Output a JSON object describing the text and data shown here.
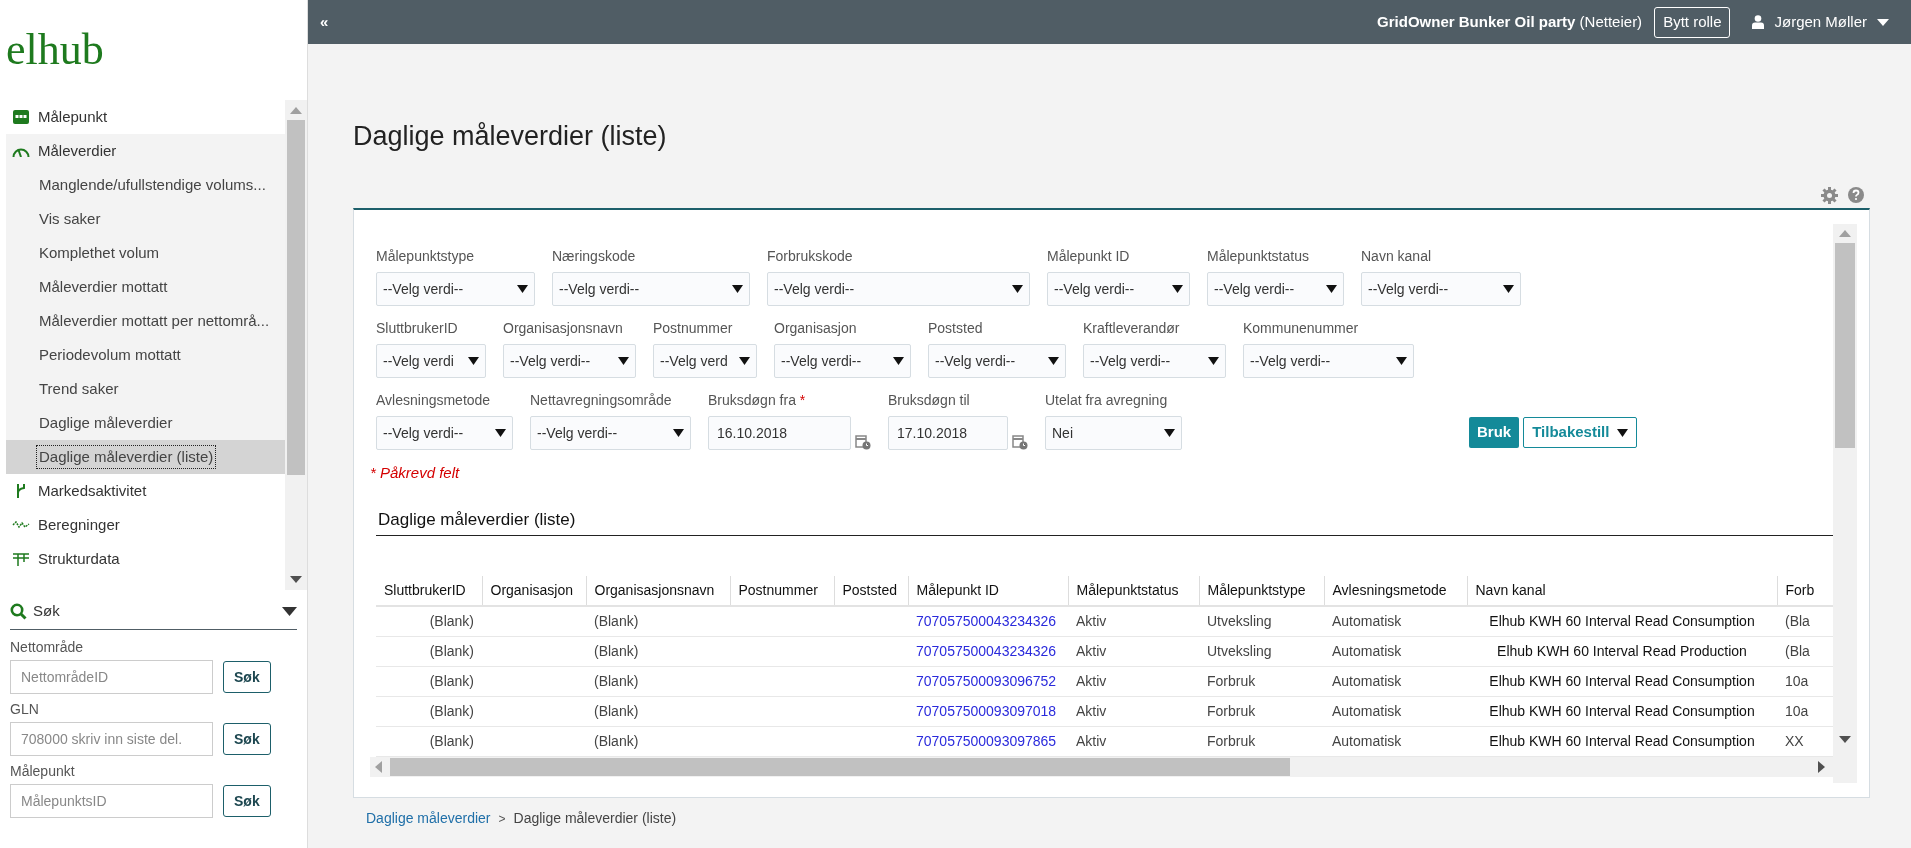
{
  "topbar": {
    "collapse": "«",
    "organization": "GridOwner Bunker Oil party",
    "role": "(Netteier)",
    "switch_role": "Bytt rolle",
    "user": "Jørgen Møller"
  },
  "logo": "elhub",
  "sidebar": {
    "items": [
      {
        "label": "Målepunkt",
        "expanded": false,
        "selected": false
      },
      {
        "label": "Måleverdier",
        "expanded": true,
        "selected": false,
        "children": [
          {
            "label": "Manglende/ufullstendige volums...",
            "selected": false
          },
          {
            "label": "Vis saker",
            "selected": false
          },
          {
            "label": "Komplethet volum",
            "selected": false
          },
          {
            "label": "Måleverdier mottatt",
            "selected": false
          },
          {
            "label": "Måleverdier mottatt per nettområ...",
            "selected": false
          },
          {
            "label": "Periodevolum mottatt",
            "selected": false
          },
          {
            "label": "Trend saker",
            "selected": false
          },
          {
            "label": "Daglige måleverdier",
            "selected": false
          },
          {
            "label": "Daglige måleverdier (liste)",
            "selected": true
          }
        ]
      },
      {
        "label": "Markedsaktivitet",
        "expanded": false,
        "selected": false
      },
      {
        "label": "Beregninger",
        "expanded": false,
        "selected": false
      },
      {
        "label": "Strukturdata",
        "expanded": false,
        "selected": false
      }
    ]
  },
  "quick_search": {
    "title": "Søk",
    "fields": [
      {
        "label": "Nettområde",
        "placeholder": "NettområdeID",
        "button": "Søk"
      },
      {
        "label": "GLN",
        "placeholder": "708000 skriv inn siste del.",
        "button": "Søk"
      },
      {
        "label": "Målepunkt",
        "placeholder": "MålepunktsID",
        "button": "Søk"
      }
    ]
  },
  "page_title": "Daglige måleverdier (liste)",
  "filters": [
    [
      {
        "kind": "select",
        "label": "Målepunktstype",
        "value": "--Velg verdi--"
      },
      {
        "kind": "select",
        "label": "Næringskode",
        "value": "--Velg verdi--"
      },
      {
        "kind": "select",
        "label": "Forbrukskode",
        "value": "--Velg verdi--"
      },
      {
        "kind": "select",
        "label": "Målepunkt ID",
        "value": "--Velg verdi--"
      },
      {
        "kind": "select",
        "label": "Målepunktstatus",
        "value": "--Velg verdi--"
      },
      {
        "kind": "select",
        "label": "Navn kanal",
        "value": "--Velg verdi--"
      }
    ],
    [
      {
        "kind": "select",
        "label": "SluttbrukerID",
        "value": "--Velg verdi"
      },
      {
        "kind": "select",
        "label": "Organisasjonsnavn",
        "value": "--Velg verdi--"
      },
      {
        "kind": "select",
        "label": "Postnummer",
        "value": "--Velg verd"
      },
      {
        "kind": "select",
        "label": "Organisasjon",
        "value": "--Velg verdi--"
      },
      {
        "kind": "select",
        "label": "Poststed",
        "value": "--Velg verdi--"
      },
      {
        "kind": "select",
        "label": "Kraftleverandør",
        "value": "--Velg verdi--"
      },
      {
        "kind": "select",
        "label": "Kommunenummer",
        "value": "--Velg verdi--"
      }
    ],
    [
      {
        "kind": "select",
        "label": "Avlesningsmetode",
        "value": "--Velg verdi--"
      },
      {
        "kind": "select",
        "label": "Nettavregningsområde",
        "value": "--Velg verdi--"
      },
      {
        "kind": "date",
        "label": "Bruksdøgn fra",
        "required": true,
        "value": "16.10.2018"
      },
      {
        "kind": "date",
        "label": "Bruksdøgn til",
        "required": false,
        "value": "17.10.2018"
      },
      {
        "kind": "select",
        "label": "Utelat fra avregning",
        "value": "Nei"
      }
    ]
  ],
  "required_mark": "*",
  "apply_button": "Bruk",
  "reset_button": "Tilbakestill",
  "required_note": "* Påkrevd felt",
  "section_title": "Daglige måleverdier (liste)",
  "table": {
    "columns": [
      {
        "label": "SluttbrukerID",
        "kind": "right"
      },
      {
        "label": "Organisasjon"
      },
      {
        "label": "Organisasjonsnavn",
        "kind": "text"
      },
      {
        "label": "Postnummer"
      },
      {
        "label": "Poststed"
      },
      {
        "label": "Målepunkt ID",
        "kind": "link"
      },
      {
        "label": "Målepunktstatus",
        "kind": "text"
      },
      {
        "label": "Målepunktstype",
        "kind": "text"
      },
      {
        "label": "Avlesningsmetode",
        "kind": "text"
      },
      {
        "label": "Navn kanal",
        "kind": "strong"
      },
      {
        "label": "Forb",
        "kind": "text"
      }
    ],
    "rows": [
      {
        "cells": [
          "(Blank)",
          null,
          "(Blank)",
          null,
          null,
          "707057500043234326",
          "Aktiv",
          "Utveksling",
          "Automatisk",
          "Elhub KWH 60 Interval Read Consumption",
          "(Bla"
        ]
      },
      {
        "cells": [
          "(Blank)",
          null,
          "(Blank)",
          null,
          null,
          "707057500043234326",
          "Aktiv",
          "Utveksling",
          "Automatisk",
          "Elhub KWH 60 Interval Read Production",
          "(Bla"
        ]
      },
      {
        "cells": [
          "(Blank)",
          null,
          "(Blank)",
          null,
          null,
          "707057500093096752",
          "Aktiv",
          "Forbruk",
          "Automatisk",
          "Elhub KWH 60 Interval Read Consumption",
          "10a"
        ]
      },
      {
        "cells": [
          "(Blank)",
          null,
          "(Blank)",
          null,
          null,
          "707057500093097018",
          "Aktiv",
          "Forbruk",
          "Automatisk",
          "Elhub KWH 60 Interval Read Consumption",
          "10a"
        ]
      },
      {
        "cells": [
          "(Blank)",
          null,
          "(Blank)",
          null,
          null,
          "707057500093097865",
          "Aktiv",
          "Forbruk",
          "Automatisk",
          "Elhub KWH 60 Interval Read Consumption",
          "XX"
        ]
      }
    ]
  },
  "breadcrumb_separator": ">",
  "breadcrumb": [
    {
      "label": "Daglige måleverdier",
      "link": true
    },
    {
      "label": "Daglige måleverdier (liste)",
      "link": false
    }
  ]
}
